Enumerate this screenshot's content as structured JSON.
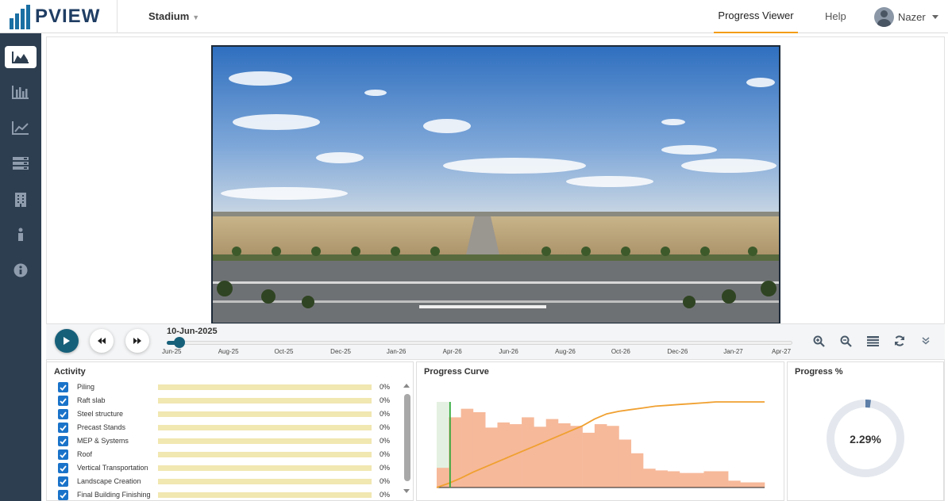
{
  "header": {
    "brand": "PVIEW",
    "project": "Stadium",
    "nav_viewer": "Progress Viewer",
    "nav_help": "Help",
    "user_name": "Nazer"
  },
  "sidebar": {
    "items": [
      {
        "icon": "area-chart-icon",
        "active": true
      },
      {
        "icon": "bar-chart-icon",
        "active": false
      },
      {
        "icon": "line-chart-icon",
        "active": false
      },
      {
        "icon": "server-icon",
        "active": false
      },
      {
        "icon": "building-icon",
        "active": false
      },
      {
        "icon": "info-icon",
        "active": false
      },
      {
        "icon": "info-circle-icon",
        "active": false
      }
    ]
  },
  "viewer": {
    "current_date": "10-Jun-2025",
    "slider_position": 0.02,
    "ticks": [
      "Jun-25",
      "Aug-25",
      "Oct-25",
      "Dec-25",
      "Jan-26",
      "Apr-26",
      "Jun-26",
      "Aug-26",
      "Oct-26",
      "Dec-26",
      "Jan-27",
      "Apr-27"
    ],
    "tools": [
      "zoom-in-icon",
      "zoom-out-icon",
      "layers-icon",
      "refresh-icon",
      "chevron-double-down-icon"
    ]
  },
  "activity": {
    "title": "Activity",
    "items": [
      {
        "label": "Piling",
        "progress": "0%",
        "checked": true
      },
      {
        "label": "Raft slab",
        "progress": "0%",
        "checked": true
      },
      {
        "label": "Steel structure",
        "progress": "0%",
        "checked": true
      },
      {
        "label": "Precast Stands",
        "progress": "0%",
        "checked": true
      },
      {
        "label": "MEP & Systems",
        "progress": "0%",
        "checked": true
      },
      {
        "label": "Roof",
        "progress": "0%",
        "checked": true
      },
      {
        "label": "Vertical Transportation",
        "progress": "0%",
        "checked": true
      },
      {
        "label": "Landscape Creation",
        "progress": "0%",
        "checked": true
      },
      {
        "label": "Final Building Finishing",
        "progress": "0%",
        "checked": true
      }
    ]
  },
  "progress_curve": {
    "title": "Progress Curve",
    "bar_values": [
      0.23,
      0.82,
      0.92,
      0.88,
      0.7,
      0.76,
      0.74,
      0.82,
      0.71,
      0.8,
      0.75,
      0.72,
      0.64,
      0.74,
      0.72,
      0.56,
      0.4,
      0.22,
      0.2,
      0.19,
      0.17,
      0.17,
      0.19,
      0.19,
      0.08,
      0.06,
      0.06
    ],
    "curve_values": [
      0.0,
      0.05,
      0.11,
      0.18,
      0.24,
      0.3,
      0.36,
      0.42,
      0.48,
      0.54,
      0.6,
      0.66,
      0.72,
      0.8,
      0.86,
      0.89,
      0.91,
      0.93,
      0.95,
      0.96,
      0.97,
      0.98,
      0.99,
      1.0,
      1.0,
      1.0,
      1.0,
      1.0
    ],
    "colors": {
      "bars": "#f6b99a",
      "curve": "#f0a030",
      "marker": "#2fa83a",
      "shade": "#e4f1e2"
    }
  },
  "progress_pct": {
    "title": "Progress %",
    "value_text": "2.29%",
    "value": 0.0229,
    "colors": {
      "track": "#e4e8ee",
      "fill": "#5d7fa8"
    }
  }
}
